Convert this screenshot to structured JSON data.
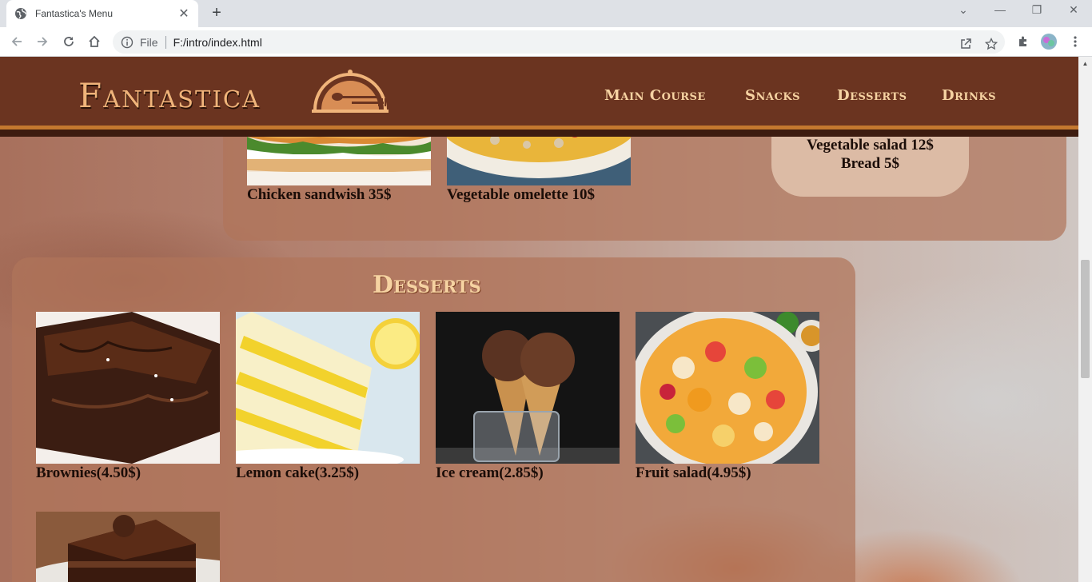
{
  "browser": {
    "tab_title": "Fantastica's Menu",
    "tab_close": "✕",
    "new_tab": "+",
    "address_scheme": "File",
    "address_url": "F:/intro/index.html",
    "window_controls": {
      "dropdown": "⌄",
      "minimize": "—",
      "restore": "❐",
      "close": "✕"
    }
  },
  "site": {
    "logo": "Fantastica",
    "nav": [
      "Main Course",
      "Snacks",
      "Desserts",
      "Drinks"
    ]
  },
  "main_course": {
    "items": [
      {
        "caption": "Chicken sandwish 35$"
      },
      {
        "caption": "Vegetable omelette 10$"
      }
    ],
    "side_list": [
      "Vegetable salad 12$",
      "Bread 5$"
    ]
  },
  "desserts": {
    "title": "Desserts",
    "items": [
      {
        "caption": "Brownies(4.50$)"
      },
      {
        "caption": "Lemon cake(3.25$)"
      },
      {
        "caption": "Ice cream(2.85$)"
      },
      {
        "caption": "Fruit salad(4.95$)"
      }
    ]
  },
  "colors": {
    "header_bg": "#6b3420",
    "accent": "#c4782f",
    "nav_text": "#f6d3a2",
    "panel_bg": "#b0745a"
  }
}
